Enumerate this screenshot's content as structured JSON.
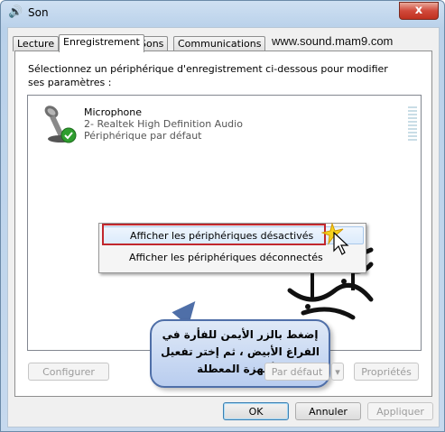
{
  "window": {
    "title": "Son",
    "close_label": "x"
  },
  "tabs": [
    {
      "label": "Lecture",
      "active": false
    },
    {
      "label": "Enregistrement",
      "active": true
    },
    {
      "label": "Sons",
      "active": false
    },
    {
      "label": "Communications",
      "active": false
    }
  ],
  "watermark": "www.sound.mam9.com",
  "instruction": "Sélectionnez un périphérique d'enregistrement ci-dessous pour modifier ses paramètres :",
  "device": {
    "name": "Microphone",
    "line2": "2- Realtek High Definition Audio",
    "line3": "Périphérique par défaut",
    "status_icon": "check-icon"
  },
  "context_menu": {
    "items": [
      {
        "label": "Afficher les périphériques désactivés",
        "highlighted": true
      },
      {
        "label": "Afficher les périphériques déconnectés",
        "highlighted": false
      }
    ]
  },
  "callout": {
    "text": "إضغط بالزر الأيمن للفأرة في الفراغ الأبيض ، ثم إختر تفعيل الأجهزة المعطلة"
  },
  "buttons": {
    "configure": "Configurer",
    "default": "Par défaut",
    "properties": "Propriétés",
    "ok": "OK",
    "cancel": "Annuler",
    "apply": "Appliquer"
  },
  "colors": {
    "highlight_border": "#c1272d",
    "accent": "#3c7fb1",
    "callout_border": "#4f6fa8"
  }
}
